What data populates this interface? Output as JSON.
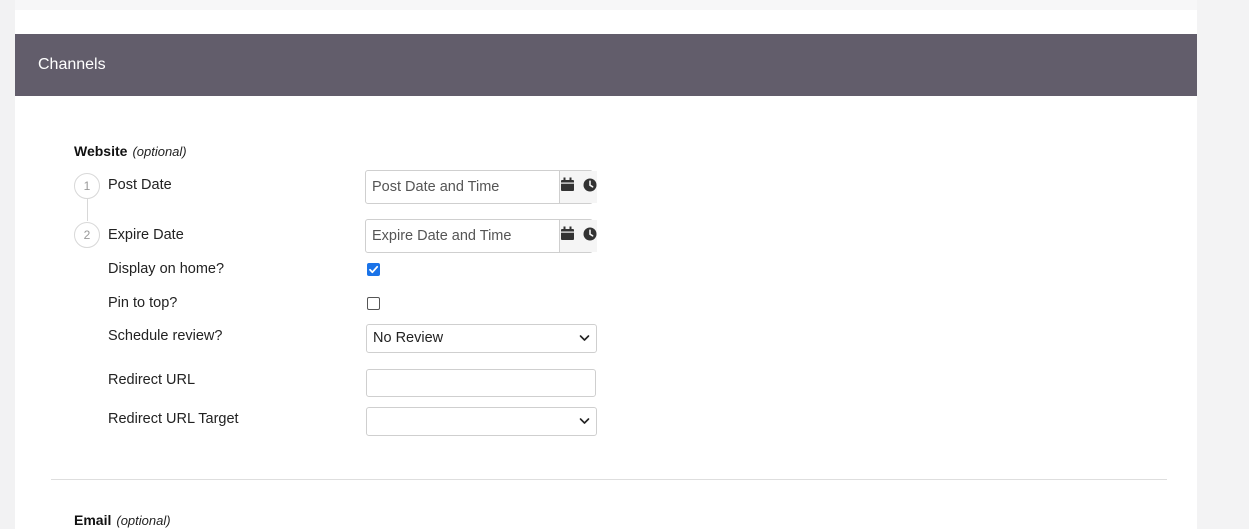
{
  "header": {
    "title": "Channels"
  },
  "website": {
    "title": "Website",
    "optional_label": "(optional)",
    "post_date": {
      "step": "1",
      "label": "Post Date",
      "placeholder": "Post Date and Time"
    },
    "expire_date": {
      "step": "2",
      "label": "Expire Date",
      "placeholder": "Expire Date and Time"
    },
    "display_on_home": {
      "label": "Display on home?",
      "checked": true
    },
    "pin_to_top": {
      "label": "Pin to top?",
      "checked": false
    },
    "schedule_review": {
      "label": "Schedule review?",
      "value": "No Review"
    },
    "redirect_url": {
      "label": "Redirect URL",
      "value": ""
    },
    "redirect_url_target": {
      "label": "Redirect URL Target",
      "value": ""
    }
  },
  "email": {
    "title": "Email",
    "optional_label": "(optional)"
  },
  "icons": {
    "calendar": "calendar-icon",
    "clock": "clock-icon",
    "chevron": "chevron-down-icon",
    "check": "checkmark-icon"
  },
  "colors": {
    "header_bg": "#625d6b",
    "checkbox_on": "#1a73e8"
  }
}
